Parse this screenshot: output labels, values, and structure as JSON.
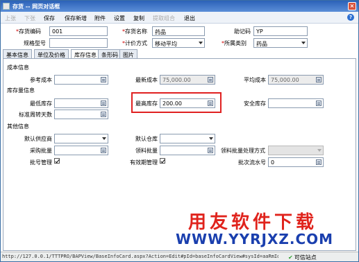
{
  "window": {
    "title": "存货 -- 网页对话框"
  },
  "toolbar": {
    "prev": "上张",
    "next": "下张",
    "save": "保存",
    "save_new": "保存新增",
    "attach": "附件",
    "settings": "设置",
    "copy": "复制",
    "extract": "提取组合",
    "exit": "退出"
  },
  "header": {
    "code_label": "存货编码",
    "code_value": "001",
    "name_label": "存货名称",
    "name_value": "药品",
    "mnemonic_label": "助记码",
    "mnemonic_value": "YP",
    "spec_label": "规格型号",
    "spec_value": "",
    "valuation_label": "计价方式",
    "valuation_value": "移动平均",
    "category_label": "所属类别",
    "category_value": "药品"
  },
  "tabs": [
    "基本信息",
    "单位及价格",
    "库存信息",
    "条形码",
    "图片"
  ],
  "cost": {
    "section": "成本信息",
    "ref_label": "参考成本",
    "ref_value": "",
    "latest_label": "最新成本",
    "latest_value": "75,000.00",
    "avg_label": "平均成本",
    "avg_value": "75,000.00"
  },
  "stock": {
    "section": "库存量信息",
    "min_label": "最低库存",
    "min_value": "",
    "max_label": "最高库存",
    "max_value": "200.00",
    "safe_label": "安全库存",
    "safe_value": "",
    "turnover_label": "标准周转天数",
    "turnover_value": ""
  },
  "other": {
    "section": "其他信息",
    "supplier_label": "默认供应商",
    "supplier_value": "",
    "warehouse_label": "默认仓库",
    "warehouse_value": "",
    "purchase_batch_label": "采购批量",
    "purchase_batch_value": "",
    "pick_batch_label": "领料批量",
    "pick_batch_value": "",
    "pick_method_label": "领料批量处理方式",
    "pick_method_value": "",
    "batch_mgmt_label": "批号管理",
    "expiry_mgmt_label": "有效期管理",
    "batch_serial_label": "批次流水号",
    "batch_serial_value": "0"
  },
  "watermark": {
    "line1": "用友软件下载",
    "line2": "WWW.YYRJXZ.COM"
  },
  "statusbar": {
    "url": "http://127.0.0.1/TTTPRO/BAPView/BaseInfoCard.aspx?Action=Edit#pId=baseInfoCardView#sysId=aaRmId=",
    "trusted": "可信站点"
  },
  "colors": {
    "title_bar": "#2c62b8",
    "highlight_box": "#e02020",
    "required_mark": "#d00000",
    "watermark_red": "#e0231c",
    "watermark_blue": "#1a3fae"
  }
}
